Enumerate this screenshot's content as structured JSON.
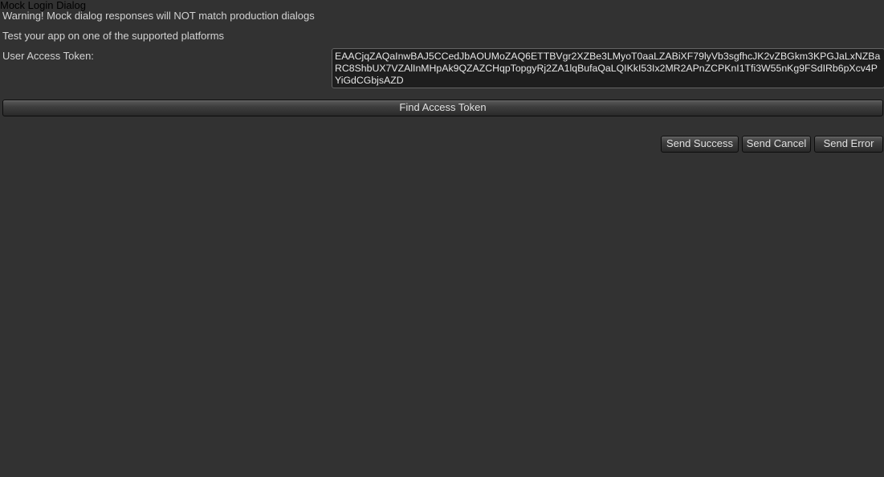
{
  "window": {
    "title": "Mock Login Dialog"
  },
  "messages": {
    "warning": "Warning! Mock dialog responses will NOT match production dialogs",
    "info": "Test your app on one of the supported platforms"
  },
  "token": {
    "label": "User Access Token:",
    "value": "EAACjqZAQaInwBAJ5CCedJbAOUMoZAQ6ETTBVgr2XZBe3LMyoT0aaLZABiXF79lyVb3sgfhcJK2vZBGkm3KPGJaLxNZBaRC8ShbUX7VZAlInMHpAk9QZAZCHqpTopgyRj2ZA1lqBufaQaLQIKkI53Ix2MR2APnZCPKnI1Tfi3W55nKg9FSdIRb6pXcv4PYiGdCGbjsAZD"
  },
  "buttons": {
    "find_token": "Find Access Token",
    "send_success": "Send Success",
    "send_cancel": "Send Cancel",
    "send_error": "Send Error"
  },
  "colors": {
    "background": "#323232",
    "text": "#d2d2d2",
    "field_background": "#1e1e1e"
  }
}
